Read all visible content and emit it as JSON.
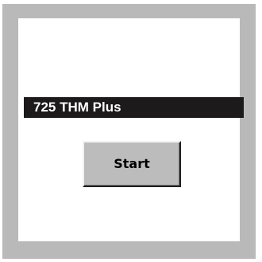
{
  "title": "725 THM Plus",
  "start_button": {
    "label": "Start"
  },
  "colors": {
    "frame": "#b9b9b9",
    "panel": "#ffffff",
    "title_bar": "#1c1a1b",
    "title_text": "#ffffff",
    "button_face": "#bcbcbc"
  }
}
